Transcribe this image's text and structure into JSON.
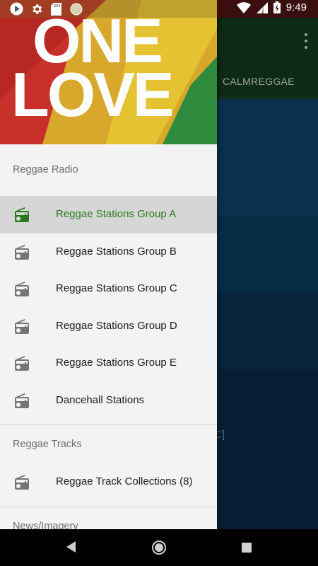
{
  "status_bar": {
    "time": "9:49",
    "left_icons": [
      "play-circle-icon",
      "gear-icon",
      "sd-card-icon",
      "record-dot-icon"
    ],
    "right_icons": [
      "wifi-icon",
      "signal-icon",
      "battery-charging-icon"
    ]
  },
  "banner": {
    "line1": "ONE",
    "line2": "LOVE",
    "colors": [
      "#c8302a",
      "#e4c232",
      "#2e8a3c"
    ]
  },
  "background_app": {
    "tab_label": "CALMREGGAE",
    "partial_text": "C]",
    "menu_icon": "more-vert-icon"
  },
  "drawer": {
    "sections": [
      {
        "header": "Reggae Radio",
        "items": [
          {
            "label": "Reggae Stations Group A",
            "icon": "radio-icon",
            "active": true
          },
          {
            "label": "Reggae Stations Group B",
            "icon": "radio-icon",
            "active": false
          },
          {
            "label": "Reggae Stations Group C",
            "icon": "radio-icon",
            "active": false
          },
          {
            "label": "Reggae Stations Group D",
            "icon": "radio-icon",
            "active": false
          },
          {
            "label": "Reggae Stations Group E",
            "icon": "radio-icon",
            "active": false
          },
          {
            "label": "Dancehall Stations",
            "icon": "radio-icon",
            "active": false
          }
        ]
      },
      {
        "header": "Reggae Tracks",
        "items": [
          {
            "label": "Reggae Track Collections (8)",
            "icon": "radio-icon",
            "active": false
          }
        ]
      },
      {
        "header": "News/Imagery",
        "items": []
      }
    ],
    "active_color": "#2b7a1c"
  },
  "nav_bar": {
    "buttons": [
      "back-icon",
      "home-icon",
      "recents-icon"
    ]
  }
}
